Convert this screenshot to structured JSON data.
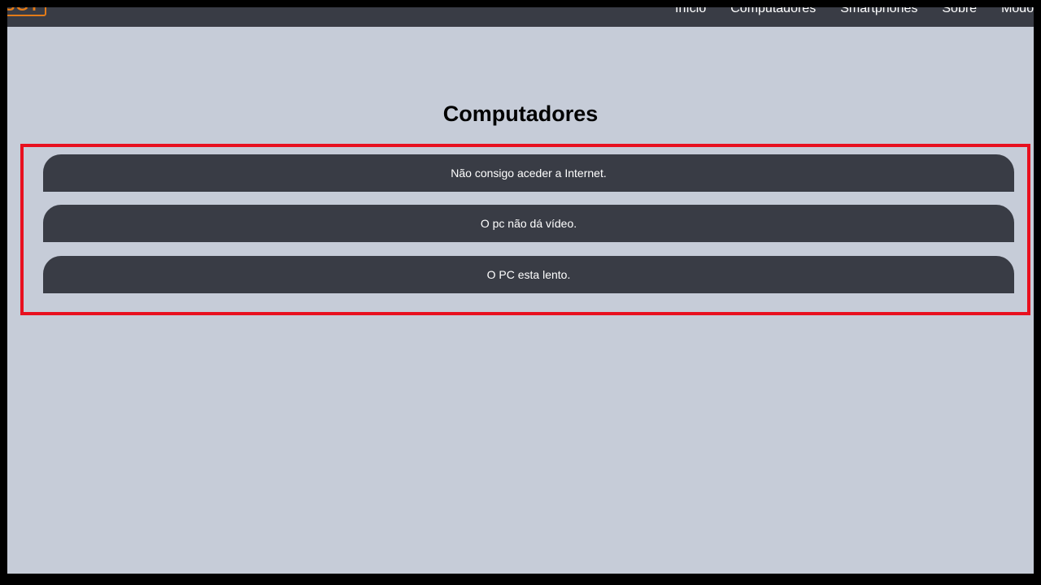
{
  "nav": {
    "logo": "SGT",
    "links": [
      "Início",
      "Computadores",
      "Smartphones",
      "Sobre",
      "Modo Noturno"
    ]
  },
  "page": {
    "title": "Computadores"
  },
  "issues": [
    "Não consigo aceder a Internet.",
    "O pc não dá vídeo.",
    "O PC esta lento."
  ],
  "colors": {
    "background": "#c6ccd8",
    "navbar": "#393c45",
    "item": "#393c45",
    "logo_accent": "#e37b18",
    "highlight": "#e8101f"
  }
}
